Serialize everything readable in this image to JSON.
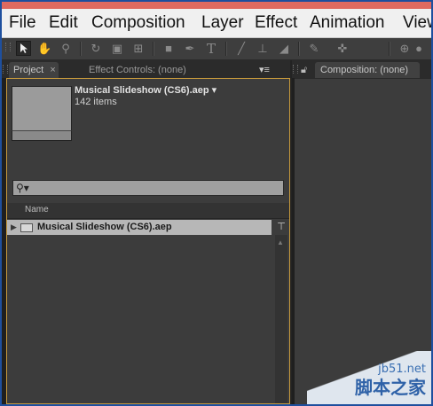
{
  "menu": [
    "File",
    "Edit",
    "Composition",
    "Layer",
    "Effect",
    "Animation",
    "View"
  ],
  "toolbar": {
    "tools": [
      "selection-tool",
      "hand-tool",
      "zoom-tool",
      "rotate-tool",
      "camera-tool",
      "pan-behind-tool",
      "rectangle-tool",
      "pen-tool",
      "type-tool",
      "brush-tool",
      "clone-stamp-tool",
      "eraser-tool",
      "roto-brush-tool",
      "puppet-tool"
    ]
  },
  "project_panel": {
    "tab_label": "Project",
    "tab_close": "×",
    "effect_controls_label": "Effect Controls: (none)",
    "menu_glyph": "▾≡",
    "project_name": "Musical Slideshow (CS6).aep ▾",
    "item_count": "142 items",
    "search_placeholder": "",
    "column_name": "Name",
    "row_name": "Musical Slideshow (CS6).aep"
  },
  "composition_panel": {
    "tab_label": "Composition: (none)",
    "menu_glyph": "▾≡"
  },
  "watermark": {
    "line1": "jb51.net",
    "line2": "脚本之家"
  }
}
